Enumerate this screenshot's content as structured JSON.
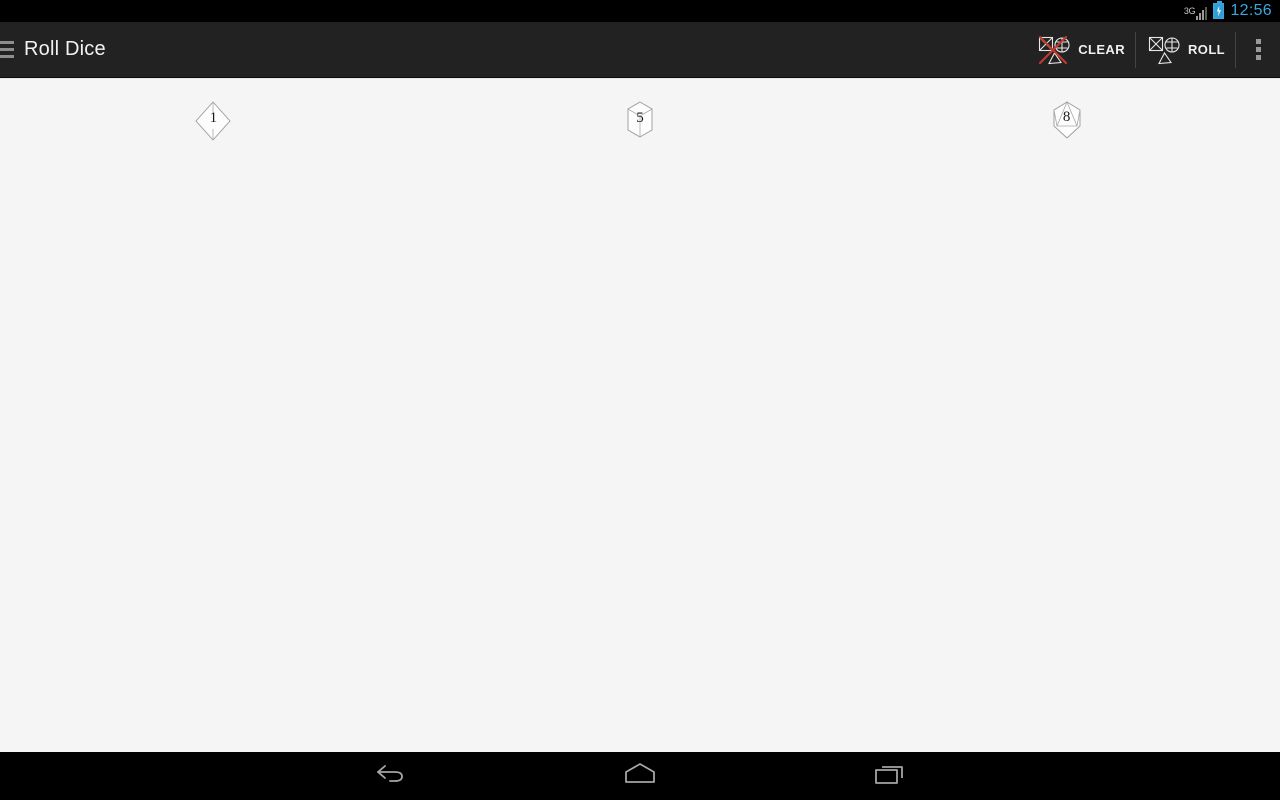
{
  "status_bar": {
    "network_label": "3G",
    "signal_icon": "signal-bars-icon",
    "battery_icon": "battery-charging-icon",
    "clock": "12:56",
    "accent_color": "#3aa6df"
  },
  "action_bar": {
    "background_color": "#222222",
    "drawer_icon": "hamburger-menu-icon",
    "title": "Roll Dice",
    "actions": [
      {
        "label": "CLEAR",
        "icon": "dice-clear-icon",
        "accent_color": "#c0392b"
      },
      {
        "label": "ROLL",
        "icon": "dice-roll-icon"
      }
    ],
    "overflow_icon": "overflow-menu-icon"
  },
  "content": {
    "background_color": "#f5f5f5",
    "dice": [
      {
        "type": "d4",
        "shape": "tetrahedron-die-icon",
        "value": "1"
      },
      {
        "type": "d6",
        "shape": "cube-die-icon",
        "value": "5"
      },
      {
        "type": "d20",
        "shape": "icosahedron-die-icon",
        "value": "8"
      }
    ]
  },
  "nav_bar": {
    "background_color": "#000000",
    "buttons": [
      {
        "name": "back",
        "icon": "back-arrow-icon"
      },
      {
        "name": "home",
        "icon": "home-icon"
      },
      {
        "name": "recents",
        "icon": "recents-icon"
      }
    ]
  }
}
